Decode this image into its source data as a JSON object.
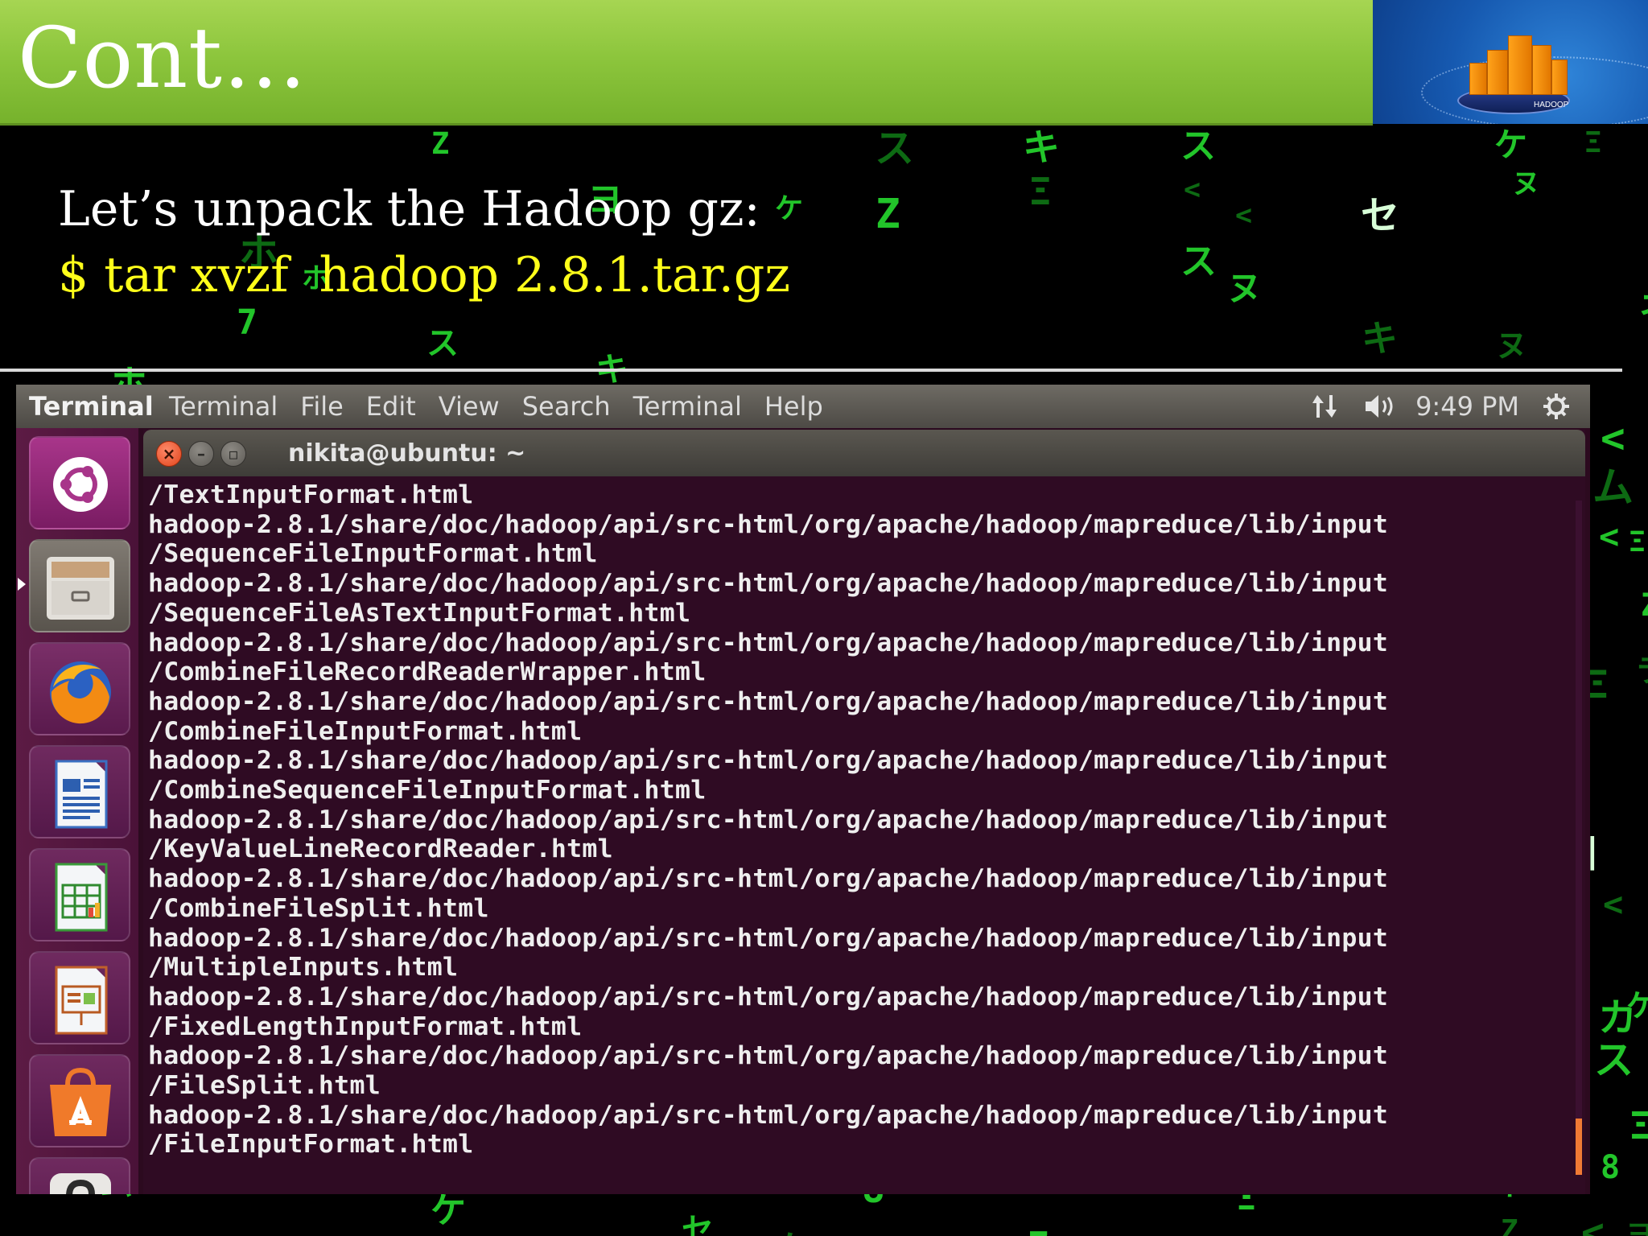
{
  "slide": {
    "title": "Cont…",
    "line1": "Let’s unpack the Hadoop gz:",
    "line2": "$ tar xvzf  hadoop 2.8.1.tar.gz"
  },
  "logo": {
    "label": "HADOOP",
    "icon": "hadoop-logo-icon"
  },
  "panel": {
    "app_name": "Terminal",
    "menu": [
      "Terminal",
      "File",
      "Edit",
      "View",
      "Search",
      "Terminal",
      "Help"
    ],
    "clock": "9:49 PM",
    "indicator_icons": [
      "network-icon",
      "volume-icon",
      "settings-gear-icon"
    ]
  },
  "launcher": {
    "items": [
      {
        "name": "ubuntu-dash-icon"
      },
      {
        "name": "files-icon"
      },
      {
        "name": "firefox-icon"
      },
      {
        "name": "libreoffice-writer-icon"
      },
      {
        "name": "libreoffice-calc-icon"
      },
      {
        "name": "libreoffice-impress-icon"
      },
      {
        "name": "software-center-icon"
      },
      {
        "name": "help-icon"
      }
    ]
  },
  "terminal": {
    "title": "nikita@ubuntu: ~",
    "lines": [
      "/TextInputFormat.html",
      "hadoop-2.8.1/share/doc/hadoop/api/src-html/org/apache/hadoop/mapreduce/lib/input",
      "/SequenceFileInputFormat.html",
      "hadoop-2.8.1/share/doc/hadoop/api/src-html/org/apache/hadoop/mapreduce/lib/input",
      "/SequenceFileAsTextInputFormat.html",
      "hadoop-2.8.1/share/doc/hadoop/api/src-html/org/apache/hadoop/mapreduce/lib/input",
      "/CombineFileRecordReaderWrapper.html",
      "hadoop-2.8.1/share/doc/hadoop/api/src-html/org/apache/hadoop/mapreduce/lib/input",
      "/CombineFileInputFormat.html",
      "hadoop-2.8.1/share/doc/hadoop/api/src-html/org/apache/hadoop/mapreduce/lib/input",
      "/CombineSequenceFileInputFormat.html",
      "hadoop-2.8.1/share/doc/hadoop/api/src-html/org/apache/hadoop/mapreduce/lib/input",
      "/KeyValueLineRecordReader.html",
      "hadoop-2.8.1/share/doc/hadoop/api/src-html/org/apache/hadoop/mapreduce/lib/input",
      "/CombineFileSplit.html",
      "hadoop-2.8.1/share/doc/hadoop/api/src-html/org/apache/hadoop/mapreduce/lib/input",
      "/MultipleInputs.html",
      "hadoop-2.8.1/share/doc/hadoop/api/src-html/org/apache/hadoop/mapreduce/lib/input",
      "/FixedLengthInputFormat.html",
      "hadoop-2.8.1/share/doc/hadoop/api/src-html/org/apache/hadoop/mapreduce/lib/input",
      "/FileSplit.html",
      "hadoop-2.8.1/share/doc/hadoop/api/src-html/org/apache/hadoop/mapreduce/lib/input",
      "/FileInputFormat.html"
    ]
  },
  "colors": {
    "title_bar": "#8dc63d",
    "command_text": "#ffff1a",
    "terminal_bg": "#2f0b23",
    "matrix_green": "#22c52a"
  }
}
